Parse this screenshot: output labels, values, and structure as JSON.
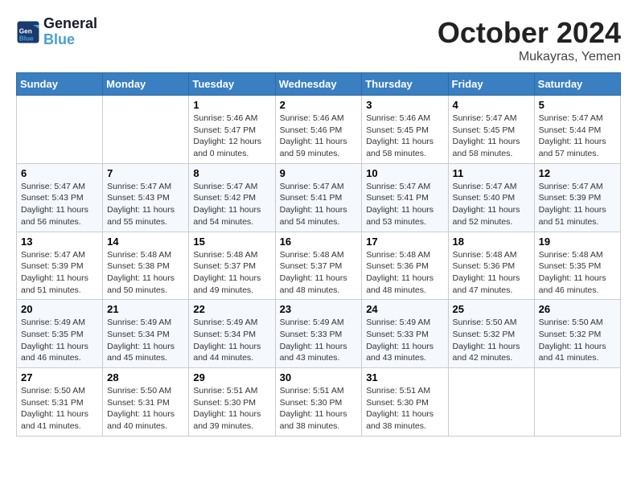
{
  "header": {
    "logo_line1": "General",
    "logo_line2": "Blue",
    "month_title": "October 2024",
    "location": "Mukayras, Yemen"
  },
  "weekdays": [
    "Sunday",
    "Monday",
    "Tuesday",
    "Wednesday",
    "Thursday",
    "Friday",
    "Saturday"
  ],
  "weeks": [
    [
      {
        "day": "",
        "info": ""
      },
      {
        "day": "",
        "info": ""
      },
      {
        "day": "1",
        "info": "Sunrise: 5:46 AM\nSunset: 5:47 PM\nDaylight: 12 hours\nand 0 minutes."
      },
      {
        "day": "2",
        "info": "Sunrise: 5:46 AM\nSunset: 5:46 PM\nDaylight: 11 hours\nand 59 minutes."
      },
      {
        "day": "3",
        "info": "Sunrise: 5:46 AM\nSunset: 5:45 PM\nDaylight: 11 hours\nand 58 minutes."
      },
      {
        "day": "4",
        "info": "Sunrise: 5:47 AM\nSunset: 5:45 PM\nDaylight: 11 hours\nand 58 minutes."
      },
      {
        "day": "5",
        "info": "Sunrise: 5:47 AM\nSunset: 5:44 PM\nDaylight: 11 hours\nand 57 minutes."
      }
    ],
    [
      {
        "day": "6",
        "info": "Sunrise: 5:47 AM\nSunset: 5:43 PM\nDaylight: 11 hours\nand 56 minutes."
      },
      {
        "day": "7",
        "info": "Sunrise: 5:47 AM\nSunset: 5:43 PM\nDaylight: 11 hours\nand 55 minutes."
      },
      {
        "day": "8",
        "info": "Sunrise: 5:47 AM\nSunset: 5:42 PM\nDaylight: 11 hours\nand 54 minutes."
      },
      {
        "day": "9",
        "info": "Sunrise: 5:47 AM\nSunset: 5:41 PM\nDaylight: 11 hours\nand 54 minutes."
      },
      {
        "day": "10",
        "info": "Sunrise: 5:47 AM\nSunset: 5:41 PM\nDaylight: 11 hours\nand 53 minutes."
      },
      {
        "day": "11",
        "info": "Sunrise: 5:47 AM\nSunset: 5:40 PM\nDaylight: 11 hours\nand 52 minutes."
      },
      {
        "day": "12",
        "info": "Sunrise: 5:47 AM\nSunset: 5:39 PM\nDaylight: 11 hours\nand 51 minutes."
      }
    ],
    [
      {
        "day": "13",
        "info": "Sunrise: 5:47 AM\nSunset: 5:39 PM\nDaylight: 11 hours\nand 51 minutes."
      },
      {
        "day": "14",
        "info": "Sunrise: 5:48 AM\nSunset: 5:38 PM\nDaylight: 11 hours\nand 50 minutes."
      },
      {
        "day": "15",
        "info": "Sunrise: 5:48 AM\nSunset: 5:37 PM\nDaylight: 11 hours\nand 49 minutes."
      },
      {
        "day": "16",
        "info": "Sunrise: 5:48 AM\nSunset: 5:37 PM\nDaylight: 11 hours\nand 48 minutes."
      },
      {
        "day": "17",
        "info": "Sunrise: 5:48 AM\nSunset: 5:36 PM\nDaylight: 11 hours\nand 48 minutes."
      },
      {
        "day": "18",
        "info": "Sunrise: 5:48 AM\nSunset: 5:36 PM\nDaylight: 11 hours\nand 47 minutes."
      },
      {
        "day": "19",
        "info": "Sunrise: 5:48 AM\nSunset: 5:35 PM\nDaylight: 11 hours\nand 46 minutes."
      }
    ],
    [
      {
        "day": "20",
        "info": "Sunrise: 5:49 AM\nSunset: 5:35 PM\nDaylight: 11 hours\nand 46 minutes."
      },
      {
        "day": "21",
        "info": "Sunrise: 5:49 AM\nSunset: 5:34 PM\nDaylight: 11 hours\nand 45 minutes."
      },
      {
        "day": "22",
        "info": "Sunrise: 5:49 AM\nSunset: 5:34 PM\nDaylight: 11 hours\nand 44 minutes."
      },
      {
        "day": "23",
        "info": "Sunrise: 5:49 AM\nSunset: 5:33 PM\nDaylight: 11 hours\nand 43 minutes."
      },
      {
        "day": "24",
        "info": "Sunrise: 5:49 AM\nSunset: 5:33 PM\nDaylight: 11 hours\nand 43 minutes."
      },
      {
        "day": "25",
        "info": "Sunrise: 5:50 AM\nSunset: 5:32 PM\nDaylight: 11 hours\nand 42 minutes."
      },
      {
        "day": "26",
        "info": "Sunrise: 5:50 AM\nSunset: 5:32 PM\nDaylight: 11 hours\nand 41 minutes."
      }
    ],
    [
      {
        "day": "27",
        "info": "Sunrise: 5:50 AM\nSunset: 5:31 PM\nDaylight: 11 hours\nand 41 minutes."
      },
      {
        "day": "28",
        "info": "Sunrise: 5:50 AM\nSunset: 5:31 PM\nDaylight: 11 hours\nand 40 minutes."
      },
      {
        "day": "29",
        "info": "Sunrise: 5:51 AM\nSunset: 5:30 PM\nDaylight: 11 hours\nand 39 minutes."
      },
      {
        "day": "30",
        "info": "Sunrise: 5:51 AM\nSunset: 5:30 PM\nDaylight: 11 hours\nand 38 minutes."
      },
      {
        "day": "31",
        "info": "Sunrise: 5:51 AM\nSunset: 5:30 PM\nDaylight: 11 hours\nand 38 minutes."
      },
      {
        "day": "",
        "info": ""
      },
      {
        "day": "",
        "info": ""
      }
    ]
  ]
}
